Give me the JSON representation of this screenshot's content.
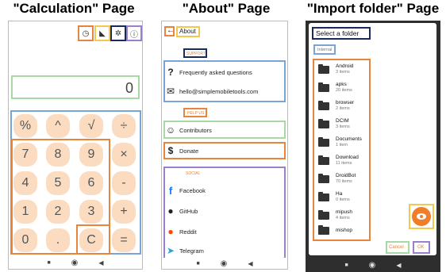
{
  "titles": {
    "calc": "\"Calculation\" Page",
    "about": "\"About\" Page",
    "import": "\"Import folder\" Page"
  },
  "nav_icons": {
    "recent": "■",
    "home": "◉",
    "back": "◀"
  },
  "calc": {
    "display_value": "0",
    "header_icons": [
      "history-icon",
      "unit-icon",
      "settings-icon",
      "info-icon"
    ],
    "header_glyphs": [
      "◷",
      "◣",
      "✲",
      "ⓘ"
    ],
    "keys": [
      [
        "%",
        "^",
        "√",
        "÷"
      ],
      [
        "7",
        "8",
        "9",
        "×"
      ],
      [
        "4",
        "5",
        "6",
        "-"
      ],
      [
        "1",
        "2",
        "3",
        "+"
      ],
      [
        "0",
        ".",
        "C",
        "="
      ]
    ]
  },
  "about": {
    "back_arrow": "←",
    "title": "About",
    "support_label": "SUPPORT",
    "support_items": [
      "Frequently asked questions",
      "hello@simplemobiletools.com"
    ],
    "support_icons": [
      "?",
      "✉"
    ],
    "help_label": "HELP US",
    "contributors": "Contributors",
    "donate": "Donate",
    "help_icons": [
      "☺",
      "$"
    ],
    "social_label": "SOCIAL",
    "social_items": [
      "Facebook",
      "GitHub",
      "Reddit",
      "Telegram"
    ],
    "social_icons": [
      "f",
      "●",
      "●",
      "➤"
    ],
    "social_colors": [
      "#1877f2",
      "#222222",
      "#ff4500",
      "#2aa1de"
    ]
  },
  "import": {
    "dialog_title": "Select a folder",
    "breadcrumb": "Internal",
    "folders": [
      {
        "name": "Android",
        "count": "3 items"
      },
      {
        "name": "apks",
        "count": "20 items"
      },
      {
        "name": "browser",
        "count": "2 items"
      },
      {
        "name": "DCIM",
        "count": "3 items"
      },
      {
        "name": "Documents",
        "count": "1 item"
      },
      {
        "name": "Download",
        "count": "11 items"
      },
      {
        "name": "DroidBot",
        "count": "70 items"
      },
      {
        "name": "Ha",
        "count": "0 items"
      },
      {
        "name": "mipush",
        "count": "4 items"
      },
      {
        "name": "mishop",
        "count": ""
      }
    ],
    "fab_icon": "eye-icon",
    "cancel": "Cancel",
    "ok": "OK"
  }
}
